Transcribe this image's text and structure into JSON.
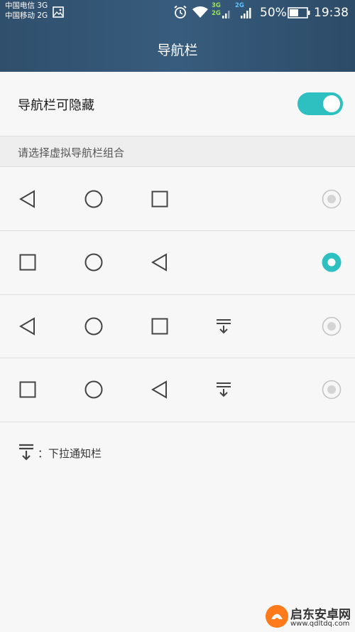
{
  "status_bar": {
    "carrier_1": "中国电信 3G",
    "carrier_2": "中国移动 2G",
    "net_tag_1": "3G",
    "net_tag_2": "2G",
    "net_tag_3": "2G",
    "battery_percent": "50%",
    "time": "19:38"
  },
  "header": {
    "title": "导航栏"
  },
  "hide_setting": {
    "label": "导航栏可隐藏",
    "enabled": true
  },
  "section": {
    "title": "请选择虚拟导航栏组合"
  },
  "options": [
    {
      "keys": [
        "back-icon",
        "home-icon",
        "recent-apps-icon"
      ],
      "selected": false
    },
    {
      "keys": [
        "recent-apps-icon",
        "home-icon",
        "back-icon"
      ],
      "selected": true
    },
    {
      "keys": [
        "back-icon",
        "home-icon",
        "recent-apps-icon",
        "notification-pulldown-icon"
      ],
      "selected": false
    },
    {
      "keys": [
        "recent-apps-icon",
        "home-icon",
        "back-icon",
        "notification-pulldown-icon"
      ],
      "selected": false
    }
  ],
  "legend": {
    "icon": "notification-pulldown-icon",
    "text": "：下拉通知栏"
  },
  "watermark": {
    "name": "启东安卓网",
    "url": "www.qdltdq.com"
  },
  "colors": {
    "accent": "#2ec0c0",
    "header": "#33536f"
  }
}
